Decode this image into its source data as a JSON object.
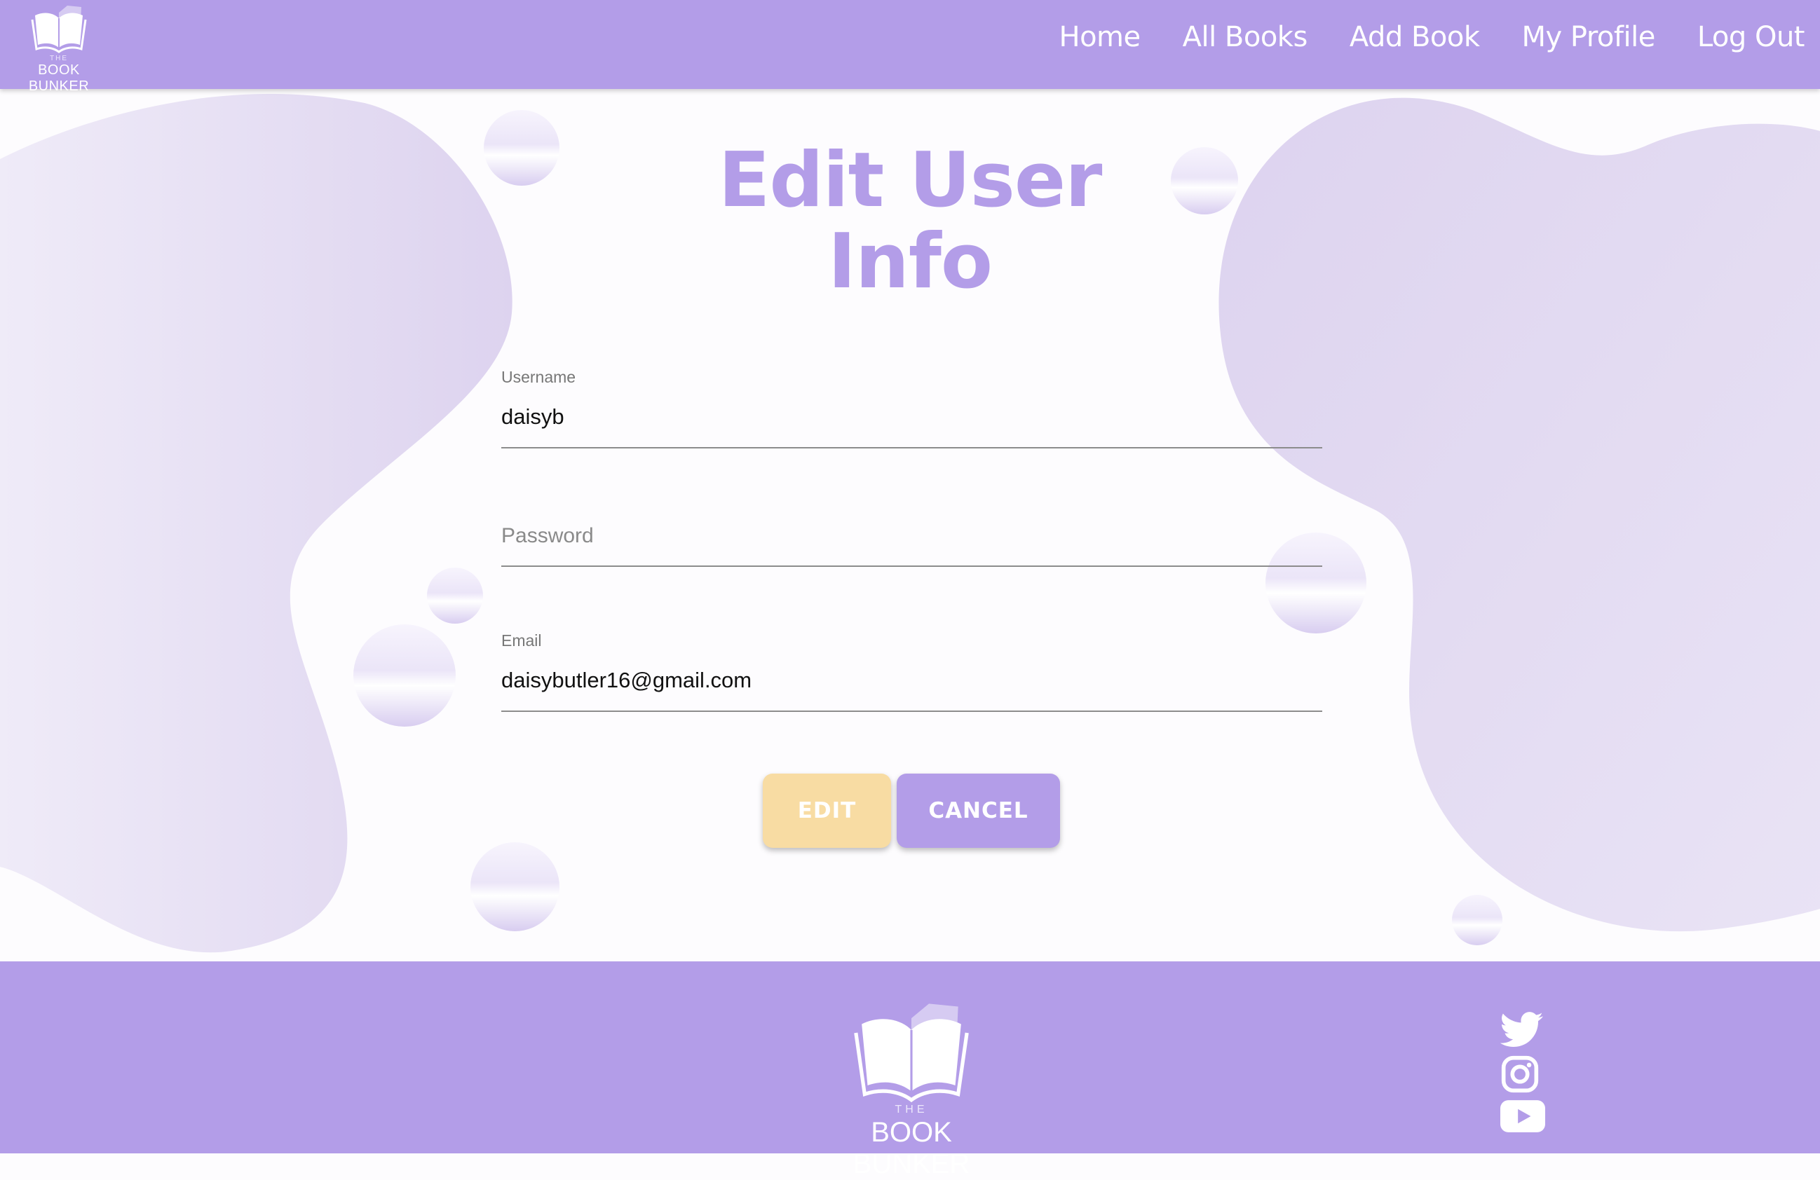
{
  "app": {
    "brand_the": "THE",
    "brand_name": "BOOK BUNKER"
  },
  "nav": {
    "items": [
      "Home",
      "All Books",
      "Add Book",
      "My Profile",
      "Log Out"
    ]
  },
  "page": {
    "title_line1": "Edit User",
    "title_line2": "Info"
  },
  "form": {
    "username_label": "Username",
    "username_value": "daisyb",
    "password_placeholder": "Password",
    "email_label": "Email",
    "email_value": "daisybutler16@gmail.com"
  },
  "buttons": {
    "edit_label": "EDIT",
    "cancel_label": "CANCEL"
  },
  "footer": {
    "brand_the": "THE",
    "brand_name": "BOOK BUNKER",
    "social_icons": [
      "twitter-icon",
      "instagram-icon",
      "youtube-icon"
    ]
  },
  "colors": {
    "accent": "#b39de8",
    "edit_button": "#f8dca3",
    "background": "#fdfcfe"
  }
}
